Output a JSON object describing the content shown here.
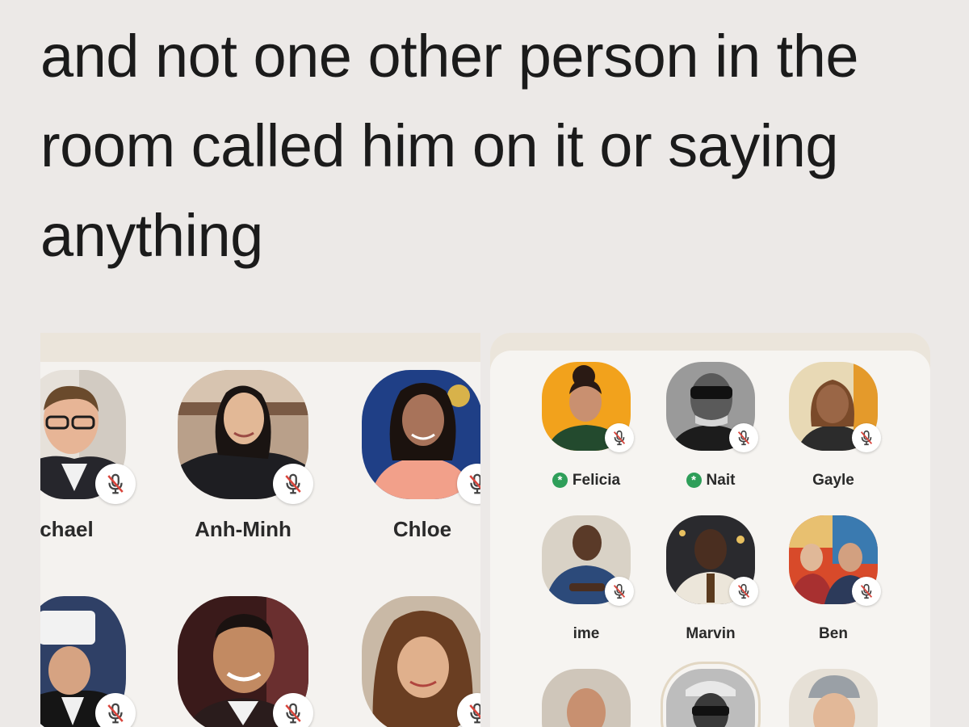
{
  "tweet": {
    "lines": [
      "and not one other person in the",
      "room called him on it or saying",
      "anything"
    ]
  },
  "colors": {
    "background": "#ece9e7",
    "panel": "#f4f2ef",
    "panel_header": "#ebe5db",
    "moderator_badge": "#2e9e59",
    "mute_slash": "#d9453c"
  },
  "left_room": {
    "speakers": [
      {
        "name": "ichael",
        "muted": true
      },
      {
        "name": "Anh-Minh",
        "muted": true
      },
      {
        "name": "Chloe",
        "muted": true
      },
      {
        "name": "",
        "muted": true
      },
      {
        "name": "",
        "muted": true
      },
      {
        "name": "",
        "muted": true
      }
    ]
  },
  "right_room": {
    "speakers": [
      {
        "name": "Felicia",
        "moderator": true,
        "muted": true
      },
      {
        "name": "Nait",
        "moderator": true,
        "muted": true
      },
      {
        "name": "Gayle",
        "moderator": false,
        "muted": true
      },
      {
        "name": "ime",
        "moderator": false,
        "muted": true
      },
      {
        "name": "Marvin",
        "moderator": false,
        "muted": true
      },
      {
        "name": "Ben",
        "moderator": false,
        "muted": true
      },
      {
        "name": "",
        "moderator": false,
        "muted": false
      },
      {
        "name": "",
        "moderator": false,
        "muted": false
      },
      {
        "name": "",
        "moderator": false,
        "muted": false
      }
    ]
  },
  "icons": {
    "mute": "mic-muted-icon",
    "moderator": "moderator-asterisk-icon"
  }
}
